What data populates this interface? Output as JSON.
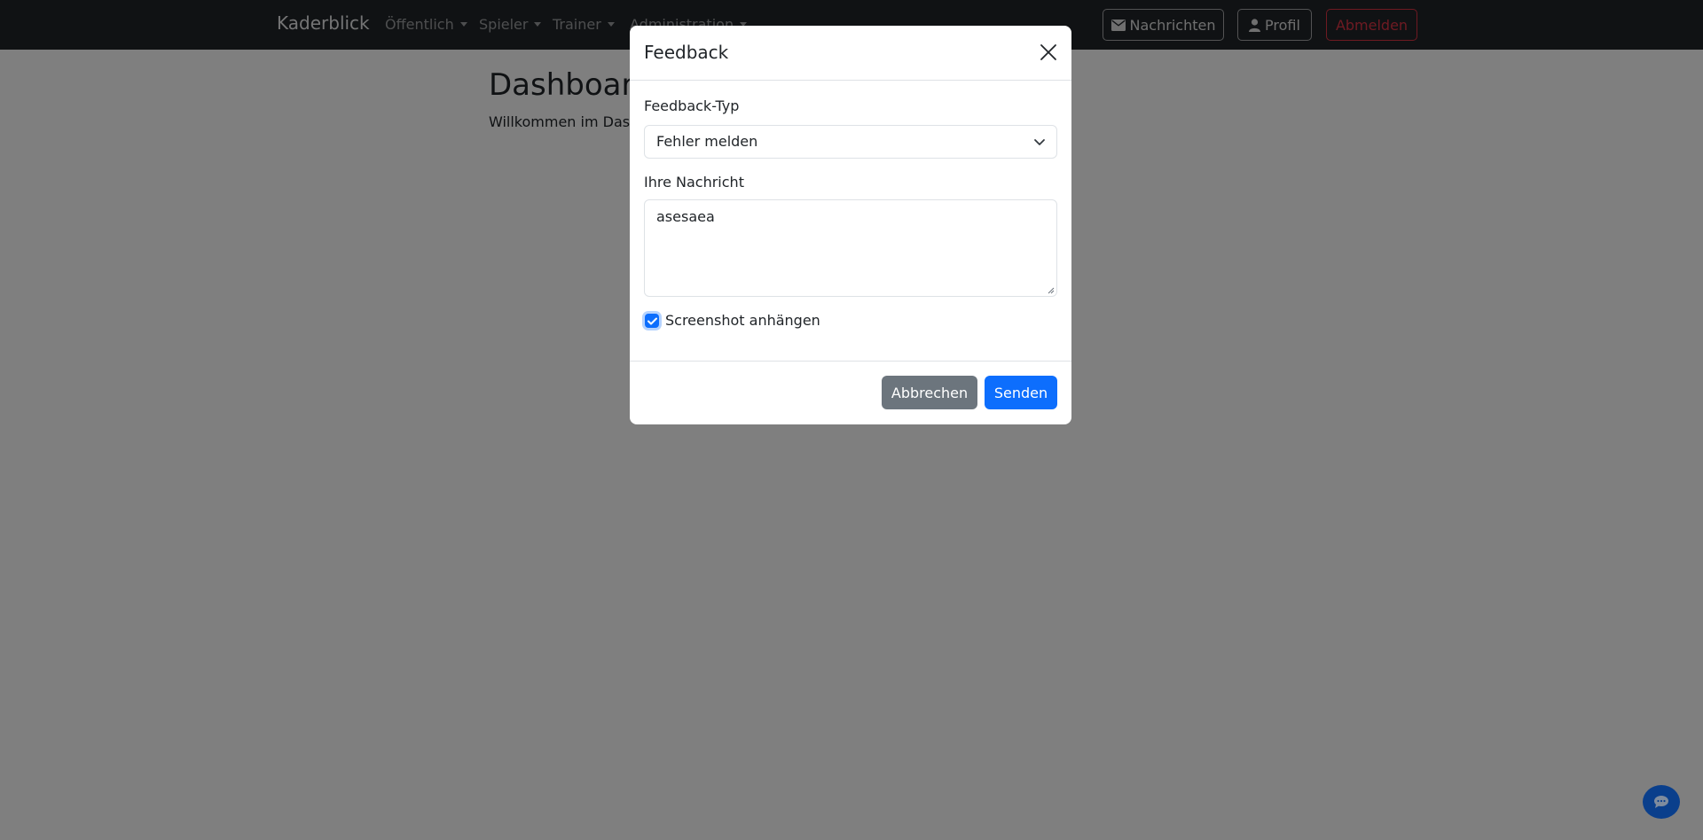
{
  "navbar": {
    "brand": "Kaderblick",
    "menus": [
      {
        "label": "Öffentlich"
      },
      {
        "label": "Spieler"
      },
      {
        "label": "Trainer"
      },
      {
        "label": "Administration"
      }
    ],
    "messages_label": "Nachrichten",
    "profile_label": "Profil",
    "logout_label": "Abmelden"
  },
  "page": {
    "title": "Dashboard",
    "lead": "Willkommen im Dashboard"
  },
  "modal": {
    "title": "Feedback",
    "type_label": "Feedback-Typ",
    "type_value": "Fehler melden",
    "message_label": "Ihre Nachricht",
    "message_value": "asesaea",
    "screenshot_label": "Screenshot anhängen",
    "screenshot_checked": true,
    "cancel_label": "Abbrechen",
    "send_label": "Senden"
  },
  "icons": {
    "messages": "envelope-icon",
    "profile": "user-icon",
    "close": "close-icon",
    "select": "chevron-down-icon",
    "checkbox": "check-icon",
    "chat": "chat-icon"
  },
  "colors": {
    "navbar": "#212529",
    "primary": "#0d6efd",
    "secondary": "#6c757d",
    "danger": "#dc3545",
    "chat": "#0a3f8c"
  }
}
